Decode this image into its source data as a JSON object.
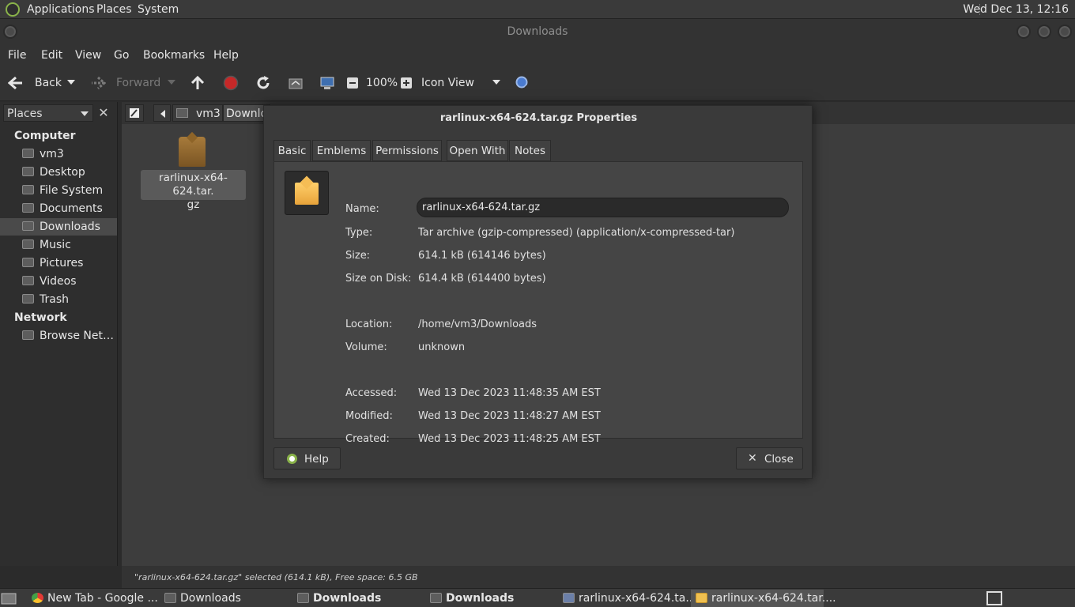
{
  "top_panel": {
    "menus": [
      "Applications",
      "Places",
      "System"
    ],
    "clock": "Wed Dec 13, 12:16"
  },
  "window": {
    "title": "Downloads",
    "menubar": [
      "File",
      "Edit",
      "View",
      "Go",
      "Bookmarks",
      "Help"
    ],
    "toolbar": {
      "back": "Back",
      "forward": "Forward",
      "zoom": "100%",
      "view_mode": "Icon View"
    }
  },
  "sidebar": {
    "combo": "Places",
    "computer_header": "Computer",
    "items": [
      "vm3",
      "Desktop",
      "File System",
      "Documents",
      "Downloads",
      "Music",
      "Pictures",
      "Videos",
      "Trash"
    ],
    "network_header": "Network",
    "network_items": [
      "Browse Net…"
    ],
    "selected": "Downloads"
  },
  "path_bar": {
    "crumbs": [
      "vm3",
      "Downlo"
    ]
  },
  "files": [
    {
      "name": "rarlinux-x64-624.tar.gz",
      "label_line1": "rarlinux-x64-624.tar.",
      "label_line2": "gz"
    }
  ],
  "status": "\"rarlinux-x64-624.tar.gz\" selected (614.1 kB), Free space: 6.5 GB",
  "dialog": {
    "title": "rarlinux-x64-624.tar.gz Properties",
    "tabs": [
      "Basic",
      "Emblems",
      "Permissions",
      "Open With",
      "Notes"
    ],
    "active_tab": "Basic",
    "labels": {
      "name": "Name:",
      "type": "Type:",
      "size": "Size:",
      "size_on_disk": "Size on Disk:",
      "location": "Location:",
      "volume": "Volume:",
      "accessed": "Accessed:",
      "modified": "Modified:",
      "created": "Created:"
    },
    "values": {
      "name": "rarlinux-x64-624.tar.gz",
      "type": "Tar archive (gzip-compressed) (application/x-compressed-tar)",
      "size": "614.1 kB (614146 bytes)",
      "size_on_disk": "614.4 kB (614400 bytes)",
      "location": "/home/vm3/Downloads",
      "volume": "unknown",
      "accessed": "Wed 13 Dec 2023 11:48:35 AM EST",
      "modified": "Wed 13 Dec 2023 11:48:27 AM EST",
      "created": "Wed 13 Dec 2023 11:48:25 AM EST"
    },
    "help_button": "Help",
    "close_button": "Close"
  },
  "taskbar": {
    "tasks": [
      {
        "label": "New Tab - Google ...",
        "icon": "chrome-icon"
      },
      {
        "label": "Downloads",
        "icon": "folder-icon"
      },
      {
        "label": "Downloads",
        "icon": "folder-icon"
      },
      {
        "label": "Downloads",
        "icon": "folder-icon"
      },
      {
        "label": "rarlinux-x64-624.ta...",
        "icon": "archive-icon"
      },
      {
        "label": "rarlinux-x64-624.tar....",
        "icon": "properties-icon"
      }
    ]
  },
  "colors": {
    "accent_green": "#8ab34a",
    "record_red": "#d32f2f",
    "search_blue": "#4a7bd0"
  }
}
